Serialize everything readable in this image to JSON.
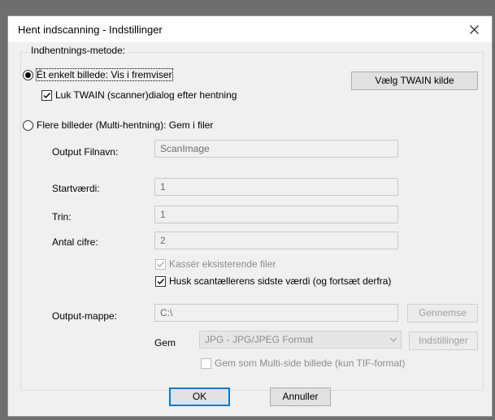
{
  "window": {
    "title": "Hent indscanning - Indstillinger",
    "close_icon": "close-icon"
  },
  "group": {
    "legend": "Indhentnings-metode:"
  },
  "single": {
    "label": "Ét enkelt billede: Vis i fremviser",
    "selected": true,
    "close_dialog_label": "Luk TWAIN (scanner)dialog efter hentning",
    "close_dialog_checked": true
  },
  "twain_button": "Vælg TWAIN kilde",
  "multi": {
    "label": "Flere billeder (Multi-hentning): Gem i filer",
    "selected": false
  },
  "fields": {
    "output_filename_label": "Output Filnavn:",
    "output_filename_value": "ScanImage",
    "start_label": "Startværdi:",
    "start_value": "1",
    "step_label": "Trin:",
    "step_value": "1",
    "digits_label": "Antal cifre:",
    "digits_value": "2"
  },
  "options": {
    "discard_label": "Kassér eksisterende filer",
    "discard_checked": true,
    "remember_label": "Husk scantællerens sidste værdi (og fortsæt derfra)",
    "remember_checked": true
  },
  "output": {
    "folder_label": "Output-mappe:",
    "folder_value": "C:\\",
    "browse_button": "Gennemse",
    "save_label": "Gem",
    "format_value": "JPG - JPG/JPEG Format",
    "settings_button": "Indstillinger",
    "multipage_label": "Gem som Multi-side billede (kun TIF-format)",
    "multipage_checked": false
  },
  "footer": {
    "ok": "OK",
    "cancel": "Annuller"
  }
}
